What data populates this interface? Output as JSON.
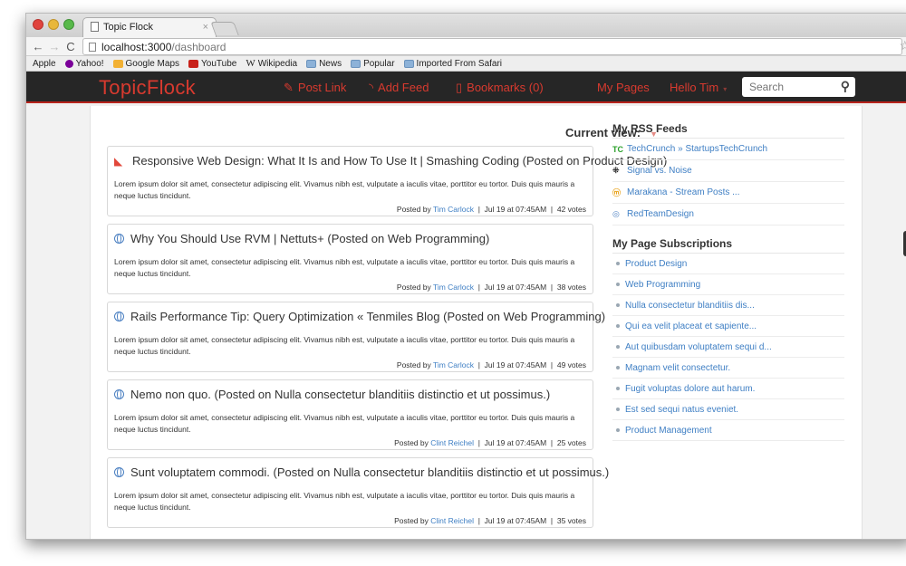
{
  "browser": {
    "tab_title": "Topic Flock",
    "tab_close": "×",
    "url_host": "localhost:3000",
    "url_path": "/dashboard",
    "bookmarks": [
      {
        "label": "Apple",
        "icon": "apple-icon"
      },
      {
        "label": "Yahoo!",
        "icon": "yahoo-icon"
      },
      {
        "label": "Google Maps",
        "icon": "google-maps-icon"
      },
      {
        "label": "YouTube",
        "icon": "youtube-icon"
      },
      {
        "label": "Wikipedia",
        "icon": "wikipedia-icon"
      },
      {
        "label": "News",
        "icon": "folder-icon"
      },
      {
        "label": "Popular",
        "icon": "folder-icon"
      },
      {
        "label": "Imported From Safari",
        "icon": "folder-icon"
      }
    ]
  },
  "header": {
    "logo": "TopicFlock",
    "post_link": "Post Link",
    "add_feed": "Add Feed",
    "bookmarks": "Bookmarks (0)",
    "my_pages": "My Pages",
    "user_menu": "Hello Tim",
    "search_placeholder": "Search",
    "accent_color": "#d83a2f"
  },
  "main": {
    "current_view_label": "Current view:",
    "posts": [
      {
        "title": "Responsive Web Design: What It Is and How To Use It | Smashing Coding (Posted on Product Design)",
        "icon": "smashing-magazine-icon",
        "body": "Lorem ipsum dolor sit amet, consectetur adipiscing elit. Vivamus nibh est, vulputate a iaculis vitae, porttitor eu tortor. Duis quis mauris a neque luctus tincidunt.",
        "posted_by": "Posted by",
        "author": "Tim Carlock",
        "sep": "|",
        "date": "Jul 19 at 07:45AM",
        "votes": "42 votes"
      },
      {
        "title": "Why You Should Use RVM | Nettuts+ (Posted on Web Programming)",
        "icon": "globe-icon",
        "body": "Lorem ipsum dolor sit amet, consectetur adipiscing elit. Vivamus nibh est, vulputate a iaculis vitae, porttitor eu tortor. Duis quis mauris a neque luctus tincidunt.",
        "posted_by": "Posted by",
        "author": "Tim Carlock",
        "sep": "|",
        "date": "Jul 19 at 07:45AM",
        "votes": "38 votes"
      },
      {
        "title": "Rails Performance Tip: Query Optimization « Tenmiles Blog (Posted on Web Programming)",
        "icon": "globe-icon",
        "body": "Lorem ipsum dolor sit amet, consectetur adipiscing elit. Vivamus nibh est, vulputate a iaculis vitae, porttitor eu tortor. Duis quis mauris a neque luctus tincidunt.",
        "posted_by": "Posted by",
        "author": "Tim Carlock",
        "sep": "|",
        "date": "Jul 19 at 07:45AM",
        "votes": "49 votes"
      },
      {
        "title": "Nemo non quo. (Posted on Nulla consectetur blanditiis distinctio et ut possimus.)",
        "icon": "globe-icon",
        "body": "Lorem ipsum dolor sit amet, consectetur adipiscing elit. Vivamus nibh est, vulputate a iaculis vitae, porttitor eu tortor. Duis quis mauris a neque luctus tincidunt.",
        "posted_by": "Posted by",
        "author": "Clint Reichel",
        "sep": "|",
        "date": "Jul 19 at 07:45AM",
        "votes": "25 votes"
      },
      {
        "title": "Sunt voluptatem commodi. (Posted on Nulla consectetur blanditiis distinctio et ut possimus.)",
        "icon": "globe-icon",
        "body": "Lorem ipsum dolor sit amet, consectetur adipiscing elit. Vivamus nibh est, vulputate a iaculis vitae, porttitor eu tortor. Duis quis mauris a neque luctus tincidunt.",
        "posted_by": "Posted by",
        "author": "Clint Reichel",
        "sep": "|",
        "date": "Jul 19 at 07:45AM",
        "votes": "35 votes"
      }
    ]
  },
  "sidebar": {
    "rss_heading": "My RSS Feeds",
    "feeds": [
      {
        "label": "TechCrunch » StartupsTechCrunch",
        "icon": "techcrunch-icon"
      },
      {
        "label": "Signal vs. Noise",
        "icon": "37signals-icon"
      },
      {
        "label": "Marakana - Stream Posts ...",
        "icon": "marakana-icon"
      },
      {
        "label": "RedTeamDesign",
        "icon": "globe-icon"
      }
    ],
    "subs_heading": "My Page Subscriptions",
    "subscriptions": [
      "Product Design",
      "Web Programming",
      "Nulla consectetur blanditiis dis...",
      "Qui ea velit placeat et sapiente...",
      "Aut quibusdam voluptatem sequi d...",
      "Magnam velit consectetur.",
      "Fugit voluptas dolore aut harum.",
      "Est sed sequi natus eveniet.",
      "Product Management"
    ]
  }
}
